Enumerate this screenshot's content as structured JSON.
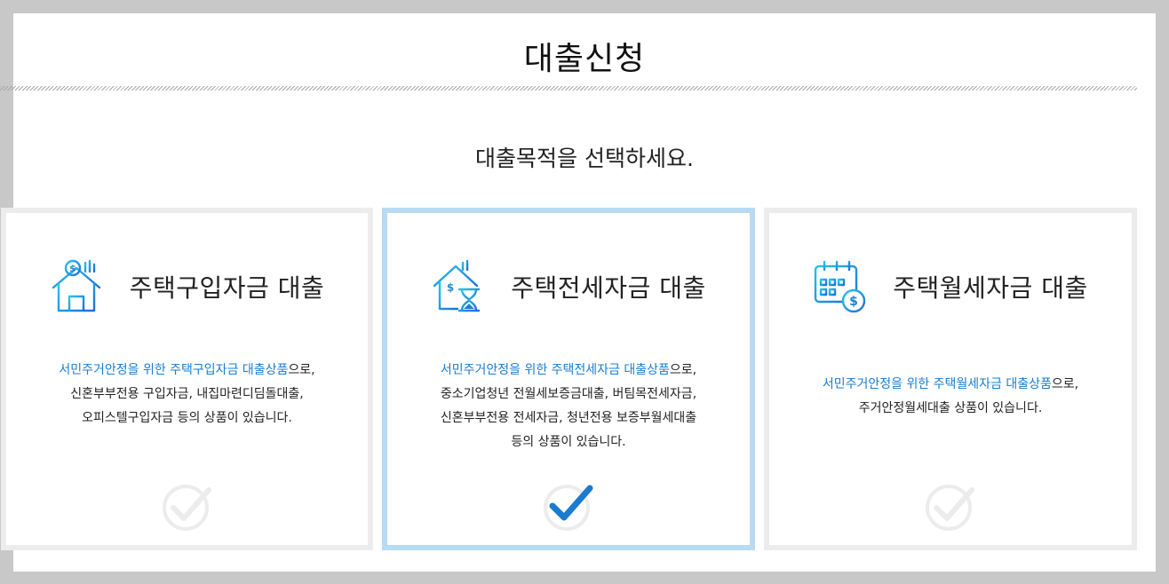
{
  "page": {
    "title": "대출신청",
    "subtitle": "대출목적을 선택하세요."
  },
  "cards": [
    {
      "id": "home-purchase",
      "title": "주택구입자금 대출",
      "icon": "house-dollar-icon",
      "selected": false,
      "highlight": "서민주거안정을 위한 주택구입자금 대출상품",
      "line1_suffix": "으로,",
      "line2": "신혼부부전용 구입자금, 내집마련디딤돌대출,",
      "line3": "오피스텔구입자금 등의 상품이 있습니다."
    },
    {
      "id": "jeonse",
      "title": "주택전세자금 대출",
      "icon": "house-hourglass-icon",
      "selected": true,
      "highlight": "서민주거안정을 위한 주택전세자금 대출상품",
      "line1_suffix": "으로,",
      "line2": "중소기업청년 전월세보증금대출, 버팀목전세자금,",
      "line3": "신혼부부전용 전세자금, 청년전용 보증부월세대출",
      "line4": "등의 상품이 있습니다."
    },
    {
      "id": "monthly-rent",
      "title": "주택월세자금 대출",
      "icon": "calendar-dollar-icon",
      "selected": false,
      "highlight": "서민주거안정을 위한 주택월세자금 대출상품",
      "line1_suffix": "으로,",
      "line2": "주거안정월세대출 상품이 있습니다."
    }
  ],
  "colors": {
    "accent": "#1a7cd1",
    "selected_border": "#b8dbf3",
    "card_border": "#ececec",
    "icon_gradient_start": "#29c5e6",
    "icon_gradient_end": "#1f6fd8"
  }
}
